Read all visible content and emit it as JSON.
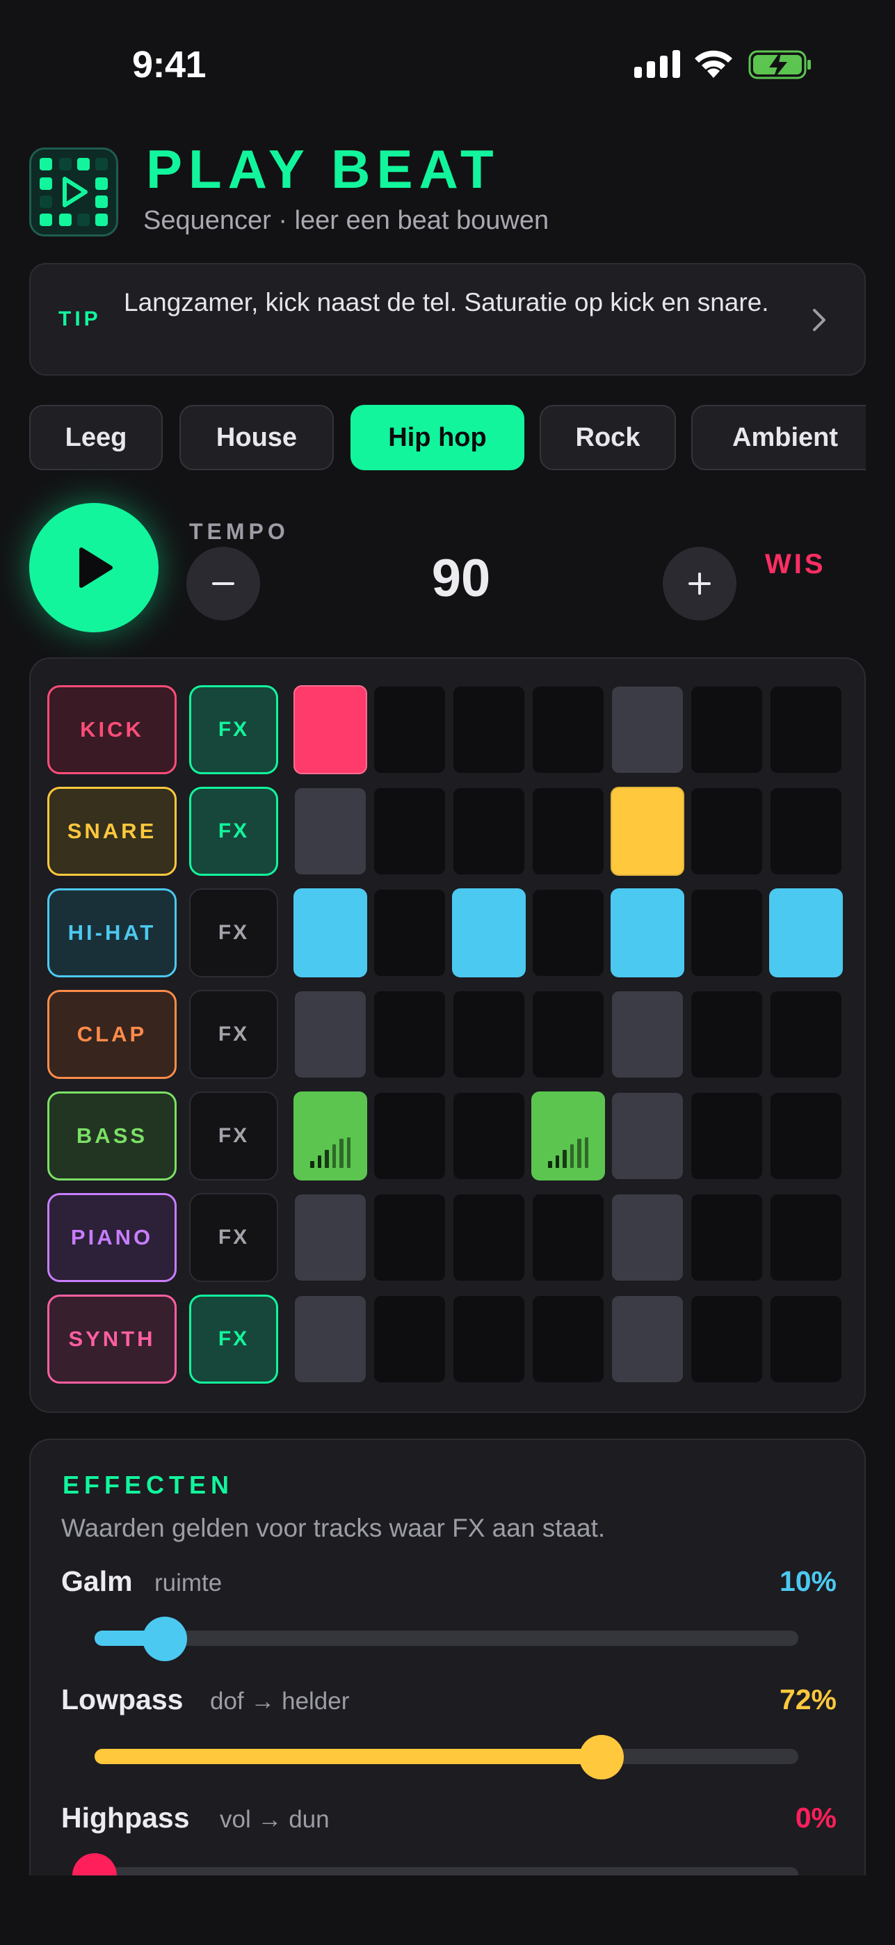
{
  "status_bar": {
    "time": "9:41"
  },
  "header": {
    "title": "PLAY BEAT",
    "subtitle": "Sequencer · leer een beat bouwen"
  },
  "tip": {
    "label": "TIP",
    "text": "Langzamer, kick naast de tel. Saturatie op kick en snare."
  },
  "presets": [
    {
      "label": "Leeg",
      "active": false
    },
    {
      "label": "House",
      "active": false
    },
    {
      "label": "Hip hop",
      "active": true
    },
    {
      "label": "Rock",
      "active": false
    },
    {
      "label": "Ambient",
      "active": false
    }
  ],
  "transport": {
    "tempo_label": "TEMPO",
    "tempo_value": "90",
    "clear_label": "WIS"
  },
  "sequencer": {
    "tracks": [
      {
        "name": "KICK",
        "color": "#ff4d79",
        "bg": "#3a1a24",
        "fx_label": "FX",
        "fx_on": true,
        "steps": [
          "on",
          "off",
          "off",
          "off",
          "ghost",
          "off",
          "off"
        ]
      },
      {
        "name": "SNARE",
        "color": "#ffc83d",
        "bg": "#36301c",
        "fx_label": "FX",
        "fx_on": true,
        "steps": [
          "ghost",
          "off",
          "off",
          "off",
          "on",
          "off",
          "off"
        ]
      },
      {
        "name": "HI-HAT",
        "color": "#4cc9f0",
        "bg": "#1a3038",
        "fx_label": "FX",
        "fx_on": false,
        "steps": [
          "on",
          "off",
          "on",
          "off",
          "on",
          "off",
          "on"
        ]
      },
      {
        "name": "CLAP",
        "color": "#ff8c4a",
        "bg": "#38251d",
        "fx_label": "FX",
        "fx_on": false,
        "steps": [
          "ghost",
          "off",
          "off",
          "off",
          "ghost",
          "off",
          "off"
        ]
      },
      {
        "name": "BASS",
        "color": "#7be065",
        "bg": "#223522",
        "fx_label": "FX",
        "fx_on": false,
        "steps": [
          "on",
          "off",
          "off",
          "on",
          "ghost",
          "off",
          "off"
        ]
      },
      {
        "name": "PIANO",
        "color": "#c77dff",
        "bg": "#2c2138",
        "fx_label": "FX",
        "fx_on": false,
        "steps": [
          "ghost",
          "off",
          "off",
          "off",
          "ghost",
          "off",
          "off"
        ]
      },
      {
        "name": "SYNTH",
        "color": "#ff5fa2",
        "bg": "#381f2d",
        "fx_label": "FX",
        "fx_on": true,
        "steps": [
          "ghost",
          "off",
          "off",
          "off",
          "ghost",
          "off",
          "off"
        ]
      }
    ]
  },
  "effects": {
    "title": "EFFECTEN",
    "description": "Waarden gelden voor tracks waar FX aan staat.",
    "items": [
      {
        "name": "Galm",
        "hint": "ruimte",
        "value_text": "10%",
        "value": 0.1,
        "color": "#4cc9f0"
      },
      {
        "name": "Lowpass",
        "hint": "dof → helder",
        "value_text": "72%",
        "value": 0.72,
        "color": "#ffc83d"
      },
      {
        "name": "Highpass",
        "hint": "vol → dun",
        "value_text": "0%",
        "value": 0.0,
        "color": "#ff1f5a"
      }
    ]
  },
  "icons": [
    "signal-icon",
    "wifi-icon",
    "battery-charging-icon",
    "app-logo-icon",
    "chevron-right-icon",
    "play-icon",
    "minus-icon",
    "plus-icon",
    "velocity-bars-icon"
  ]
}
